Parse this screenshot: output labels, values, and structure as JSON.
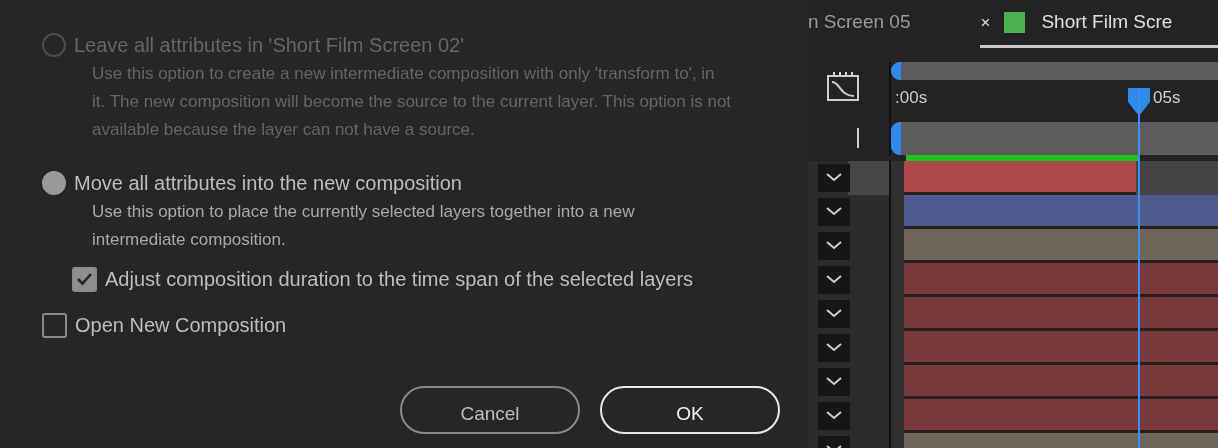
{
  "dialog": {
    "options": [
      {
        "label": "Leave all attributes in 'Short Film Screen 02'",
        "description": "Use this option to create a new intermediate composition with only 'transform to', in it. The new composition will become the source to the current layer. This option is not available because the layer can not have a source.",
        "selected": false,
        "disabled": true
      },
      {
        "label": "Move all attributes into the new composition",
        "description": "Use this option to place the currently selected layers together into a new intermediate composition.",
        "selected": true,
        "disabled": false,
        "checkboxes": [
          {
            "label": "Adjust composition duration to the time span of the selected layers",
            "checked": true
          }
        ]
      }
    ],
    "checkboxes": [
      {
        "label": "Open New Composition",
        "checked": false
      }
    ],
    "buttons": [
      {
        "label": "Cancel",
        "kind": "secondary"
      },
      {
        "label": "OK",
        "kind": "primary"
      }
    ]
  },
  "timeline": {
    "tabs": [
      {
        "label": "n Screen 05",
        "selected": false
      },
      {
        "label": "Short Film Scre",
        "selected": true,
        "close": "×",
        "color": "#4caf50"
      }
    ],
    "ruler_labels": [
      ":00s",
      "05s"
    ],
    "layers": [
      {
        "color": "#b04b4d",
        "selected": true,
        "trimmed": true
      },
      {
        "color": "#4e5b8f",
        "selected": false,
        "trimmed": false
      },
      {
        "color": "#6d6659",
        "selected": false,
        "trimmed": false
      },
      {
        "color": "#7a393b",
        "selected": false,
        "trimmed": false
      },
      {
        "color": "#7a393b",
        "selected": false,
        "trimmed": false
      },
      {
        "color": "#7a393b",
        "selected": false,
        "trimmed": false
      },
      {
        "color": "#7a393b",
        "selected": false,
        "trimmed": false
      },
      {
        "color": "#7a393b",
        "selected": false,
        "trimmed": false
      },
      {
        "color": "#6d6659",
        "selected": false,
        "trimmed": false
      }
    ]
  }
}
